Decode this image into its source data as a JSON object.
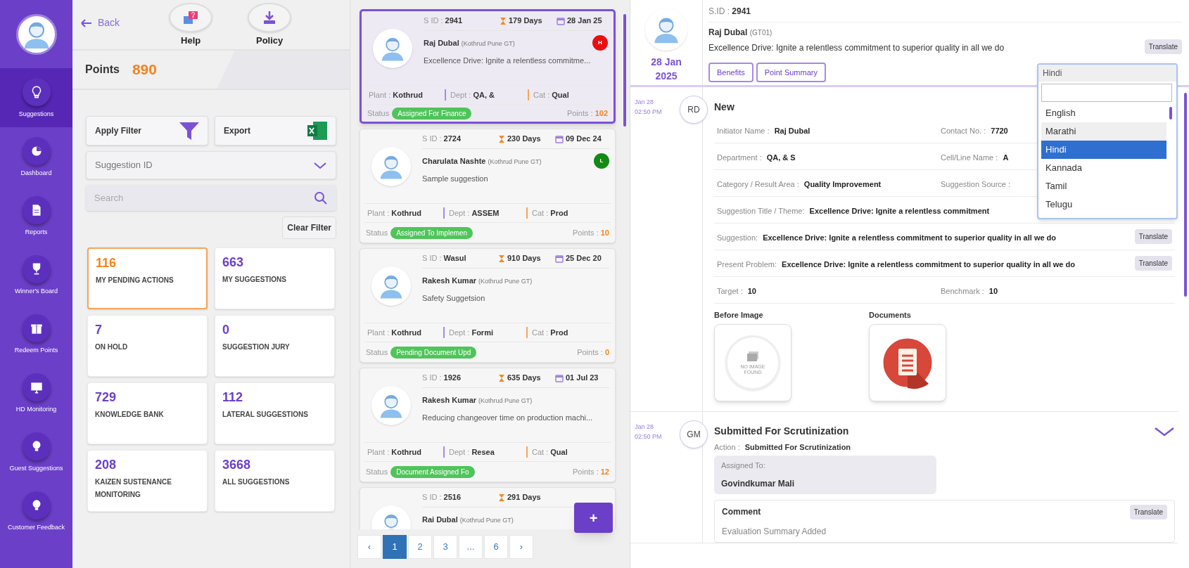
{
  "sidebar": {
    "items": [
      {
        "label": "Suggestions",
        "selected": true
      },
      {
        "label": "Dashboard",
        "selected": false
      },
      {
        "label": "Reports",
        "selected": false
      },
      {
        "label": "Winner's Board",
        "selected": false
      },
      {
        "label": "Redeem Points",
        "selected": false
      },
      {
        "label": "HD Monitoring",
        "selected": false
      },
      {
        "label": "Guest Suggestions",
        "selected": false
      },
      {
        "label": "Customer Feedback",
        "selected": false
      }
    ]
  },
  "top_bar": {
    "back": "Back",
    "help": "Help",
    "policy": "Policy"
  },
  "points": {
    "label": "Points",
    "value": "890"
  },
  "filters": {
    "apply_filter": "Apply Filter",
    "export": "Export",
    "dropdown": "Suggestion ID",
    "search_placeholder": "Search",
    "clear": "Clear Filter"
  },
  "tiles": [
    {
      "count": "116",
      "label": "MY PENDING ACTIONS",
      "selected": true
    },
    {
      "count": "663",
      "label": "MY SUGGESTIONS",
      "selected": false
    },
    {
      "count": "7",
      "label": "ON HOLD",
      "selected": false
    },
    {
      "count": "0",
      "label": "SUGGESTION JURY",
      "selected": false
    },
    {
      "count": "729",
      "label": "KNOWLEDGE BANK",
      "selected": false
    },
    {
      "count": "112",
      "label": "LATERAL SUGGESTIONS",
      "selected": false
    },
    {
      "count": "208",
      "label": "KAIZEN SUSTENANCE MONITORING",
      "selected": false
    },
    {
      "count": "3668",
      "label": "ALL SUGGESTIONS",
      "selected": false
    }
  ],
  "cards": [
    {
      "selected": true,
      "sid": [
        "S ID :",
        "2941"
      ],
      "days": "179 Days",
      "date": "28 Jan 25",
      "name": "Raj Dubal",
      "org": "(Kothrud Pune GT)",
      "badge": {
        "text": "H",
        "color": "#e81010"
      },
      "description": "Excellence Drive: Ignite a relentless commitme...",
      "plant": [
        "Plant :",
        "Kothrud"
      ],
      "dept": [
        "Dept :",
        "QA, &"
      ],
      "cat": [
        "Cat :",
        "Qual"
      ],
      "status": [
        "Status",
        "Assigned For Finance"
      ],
      "points": [
        "Points :",
        "102"
      ]
    },
    {
      "selected": false,
      "sid": [
        "S ID :",
        "2724"
      ],
      "days": "230 Days",
      "date": "09 Dec 24",
      "name": "Charulata Nashte",
      "org": "(Kothrud Pune GT)",
      "badge": {
        "text": "L",
        "color": "#138a13"
      },
      "description": "Sample suggestion",
      "plant": [
        "Plant :",
        "Kothrud"
      ],
      "dept": [
        "Dept :",
        "ASSEM"
      ],
      "cat": [
        "Cat :",
        "Prod"
      ],
      "status": [
        "Status",
        "Assigned To Implemen"
      ],
      "points": [
        "Points :",
        "10"
      ]
    },
    {
      "selected": false,
      "sid": [
        "S ID :",
        "Wasul"
      ],
      "days": "910 Days",
      "date": "25 Dec 20",
      "name": "Rakesh Kumar",
      "org": "(Kothrud Pune GT)",
      "description": "Safety Suggetsion",
      "plant": [
        "Plant :",
        "Kothrud"
      ],
      "dept": [
        "Dept :",
        "Formi"
      ],
      "cat": [
        "Cat :",
        "Prod"
      ],
      "status": [
        "Status",
        "Pending Document Upd"
      ],
      "points": [
        "Points :",
        "0"
      ]
    },
    {
      "selected": false,
      "sid": [
        "S ID :",
        "1926"
      ],
      "days": "635 Days",
      "date": "01 Jul 23",
      "name": "Rakesh Kumar",
      "org": "(Kothrud Pune GT)",
      "description": "Reducing changeover time on production machi...",
      "plant": [
        "Plant :",
        "Kothrud"
      ],
      "dept": [
        "Dept :",
        "Resea"
      ],
      "cat": [
        "Cat :",
        "Qual"
      ],
      "status": [
        "Status",
        "Document Assigned Fo"
      ],
      "points": [
        "Points :",
        "12"
      ]
    },
    {
      "selected": false,
      "sid": [
        "S ID :",
        "2516"
      ],
      "days": "291 Days",
      "name": "Rai Dubal",
      "org": "(Kothrud Pune GT)"
    }
  ],
  "fab": "+",
  "pagination": [
    {
      "label": "‹",
      "selected": false
    },
    {
      "label": "1",
      "selected": true
    },
    {
      "label": "2",
      "selected": false
    },
    {
      "label": "3",
      "selected": false
    },
    {
      "label": "...",
      "selected": false
    },
    {
      "label": "6",
      "selected": false
    },
    {
      "label": "›",
      "selected": false
    }
  ],
  "detail": {
    "sid": [
      "S.ID :",
      "2941"
    ],
    "name": "Raj Dubal",
    "code": "(GT01)",
    "description": "Excellence Drive: Ignite a relentless commitment to superior quality in all we do",
    "translate": "Translate",
    "date": [
      "28 Jan",
      "2025"
    ],
    "buttons": [
      "Benefits",
      "Point Summary"
    ]
  },
  "timeline": [
    {
      "kind": "fields",
      "date": "Jan 28",
      "time": "02:50 PM",
      "initials": "RD",
      "title": "New",
      "rows": [
        {
          "cells": [
            {
              "label": "Initiator Name :",
              "value": "Raj Dubal"
            },
            {
              "label": "Contact No. :",
              "value": "7720"
            }
          ]
        },
        {
          "cells": [
            {
              "label": "Department :",
              "value": "QA, & S"
            },
            {
              "label": "Cell/Line Name :",
              "value": "A"
            }
          ]
        },
        {
          "cells": [
            {
              "label": "Category / Result Area :",
              "value": "Quality Improvement"
            },
            {
              "label": "Suggestion Source :"
            }
          ]
        },
        {
          "cells": [
            {
              "label": "Suggestion Title / Theme:",
              "value": "Excellence Drive: Ignite a relentless commitment"
            }
          ]
        },
        {
          "cells": [
            {
              "label": "Suggestion:",
              "value": "Excellence Drive: Ignite a relentless commitment to superior quality in all we do"
            }
          ],
          "translate": "Translate"
        },
        {
          "cells": [
            {
              "label": "Present Problem:",
              "value": "Excellence Drive: Ignite a relentless commitment to superior quality in all we do"
            }
          ],
          "translate": "Translate"
        },
        {
          "cells": [
            {
              "label": "Target :",
              "value": "10"
            },
            {
              "label": "Benchmark :",
              "value": "10"
            }
          ]
        }
      ],
      "attachments": [
        {
          "kind": "no_image",
          "label": "Before Image",
          "text": "NO IMAGE FOUND"
        },
        {
          "kind": "document",
          "label": "Documents"
        }
      ]
    },
    {
      "kind": "action",
      "date": "Jan 28",
      "time": "02:50 PM",
      "initials": "GM",
      "title": "Submitted For Scrutinization",
      "action": [
        "Action :",
        "Submitted For Scrutinization"
      ],
      "assigned": [
        "Assigned To:",
        "Govindkumar Mali"
      ],
      "comment": {
        "title": "Comment",
        "translate": "Translate",
        "text": "Evaluation Summary Added"
      }
    }
  ],
  "language_dropdown": {
    "value": "Hindi",
    "options": [
      {
        "label": "English",
        "selected": false,
        "hovered": false
      },
      {
        "label": "Marathi",
        "selected": false,
        "hovered": true
      },
      {
        "label": "Hindi",
        "selected": true,
        "hovered": false
      },
      {
        "label": "Kannada",
        "selected": false,
        "hovered": false
      },
      {
        "label": "Tamil",
        "selected": false,
        "hovered": false
      },
      {
        "label": "Telugu",
        "selected": false,
        "hovered": false
      }
    ]
  }
}
